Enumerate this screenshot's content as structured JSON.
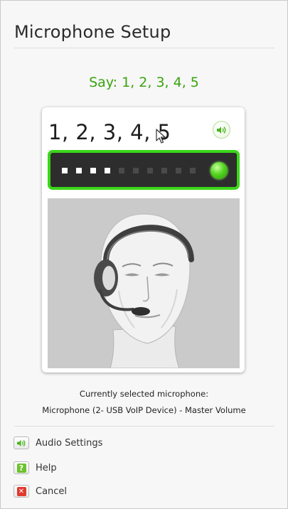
{
  "window": {
    "title": "Microphone Setup"
  },
  "prompt": {
    "instruction": "Say: 1, 2, 3, 4, 5"
  },
  "card": {
    "phrase": "1, 2, 3, 4, 5",
    "speaker_icon": "speaker-icon",
    "meter": {
      "segments_total": 10,
      "segments_active": 4,
      "indicator_color": "#3ad619"
    },
    "avatar": "headset-person-illustration"
  },
  "microphone": {
    "label": "Currently selected microphone:",
    "device": "Microphone (2- USB VoIP Device) - Master Volume"
  },
  "actions": [
    {
      "label": "Audio Settings",
      "icon": "speaker-icon"
    },
    {
      "label": "Help",
      "icon": "help-icon"
    },
    {
      "label": "Cancel",
      "icon": "cancel-icon"
    }
  ],
  "colors": {
    "accent_green": "#3aa30f",
    "meter_border": "#3ad619",
    "cancel_red": "#e03a2e"
  }
}
